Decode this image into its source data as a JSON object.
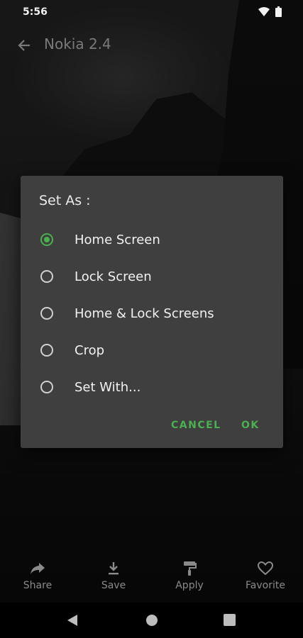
{
  "status_bar": {
    "time": "5:56"
  },
  "app_bar": {
    "title": "Nokia 2.4"
  },
  "dialog": {
    "title": "Set As :",
    "options": [
      {
        "label": "Home Screen",
        "selected": true
      },
      {
        "label": "Lock Screen",
        "selected": false
      },
      {
        "label": "Home & Lock Screens",
        "selected": false
      },
      {
        "label": "Crop",
        "selected": false
      },
      {
        "label": "Set With...",
        "selected": false
      }
    ],
    "cancel_label": "CANCEL",
    "ok_label": "OK"
  },
  "actions": [
    {
      "label": "Share",
      "icon": "share-icon"
    },
    {
      "label": "Save",
      "icon": "download-icon"
    },
    {
      "label": "Apply",
      "icon": "paint-roller-icon"
    },
    {
      "label": "Favorite",
      "icon": "heart-icon"
    }
  ],
  "colors": {
    "accent": "#4caf50",
    "dialog_bg": "#3f3f3f"
  }
}
